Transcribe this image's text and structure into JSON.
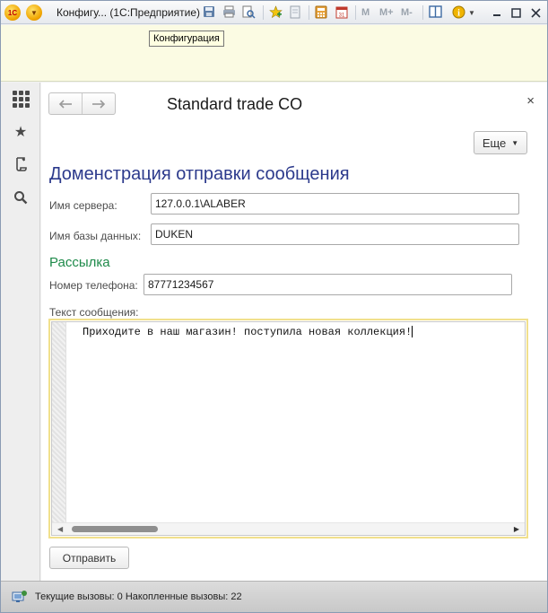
{
  "titlebar": {
    "title": "Конфигу...  (1С:Предприятие)",
    "logo": "1С",
    "m_buttons": [
      "M",
      "M+",
      "M-"
    ]
  },
  "tooltip": "Конфигурация",
  "form": {
    "title": "Standard trade CO",
    "close": "×",
    "more_label": "Еще",
    "heading": "Доменстрация отправки сообщения",
    "server_label": "Имя сервера:",
    "server_value": "127.0.0.1\\ALABER",
    "db_label": "Имя базы данных:",
    "db_value": "DUKEN",
    "mailing_heading": "Рассылка",
    "phone_label": "Номер телефона:",
    "phone_value": "87771234567",
    "message_label": "Текст сообщения:",
    "message_value": "Приходите в наш магазин! поступила новая коллекция!",
    "send_label": "Отправить"
  },
  "status": {
    "text": "Текущие вызовы: 0   Накопленные вызовы: 22"
  }
}
